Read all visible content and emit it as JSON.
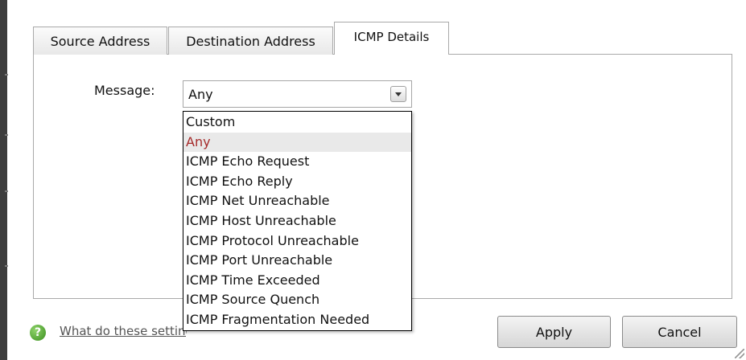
{
  "tabs": [
    {
      "label": "Source Address"
    },
    {
      "label": "Destination Address"
    },
    {
      "label": "ICMP Details"
    }
  ],
  "active_tab": "ICMP Details",
  "message": {
    "label": "Message:",
    "value": "Any",
    "options": [
      "Custom",
      "Any",
      "ICMP Echo Request",
      "ICMP Echo Reply",
      "ICMP Net Unreachable",
      "ICMP Host Unreachable",
      "ICMP Protocol Unreachable",
      "ICMP Port Unreachable",
      "ICMP Time Exceeded",
      "ICMP Source Quench",
      "ICMP Fragmentation Needed"
    ],
    "selected_color": "#a52a2a"
  },
  "help": {
    "icon": "help-icon",
    "link_text": "What do these settings mean?"
  },
  "buttons": {
    "apply": "Apply",
    "cancel": "Cancel"
  }
}
